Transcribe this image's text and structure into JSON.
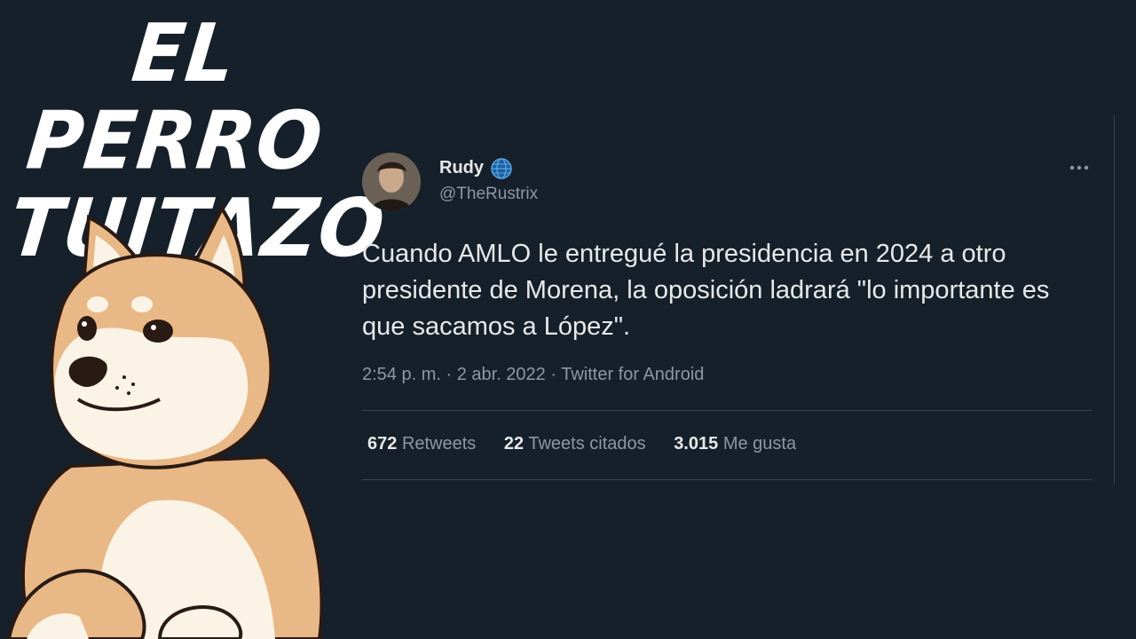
{
  "thumbnail": {
    "title_line1": "EL PERRO",
    "title_line2": "TUITAZO"
  },
  "tweet": {
    "display_name": "Rudy",
    "handle": "@TheRustrix",
    "text": "Cuando AMLO le entregué la presidencia en 2024 a otro presidente de Morena, la oposición ladrará \"lo importante es que sacamos a López\".",
    "meta": "2:54 p. m. · 2 abr. 2022 · Twitter for Android",
    "stats": {
      "retweets_count": "672",
      "retweets_label": "Retweets",
      "quotes_count": "22",
      "quotes_label": "Tweets citados",
      "likes_count": "3.015",
      "likes_label": "Me gusta"
    }
  },
  "icons": {
    "globe": "globe-icon",
    "more": "more-options-icon"
  },
  "colors": {
    "background": "#16202a",
    "text_primary": "#e7e9ea",
    "text_secondary": "#8b98a5",
    "divider": "#38444d"
  }
}
